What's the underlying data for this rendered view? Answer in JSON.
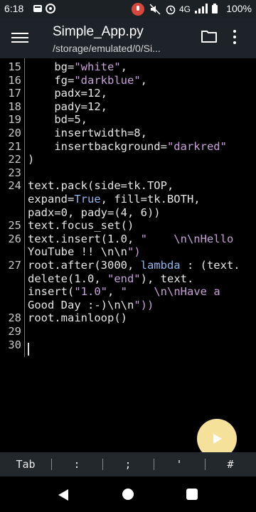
{
  "status_bar": {
    "time": "6:18",
    "network": "4G",
    "battery": "100%"
  },
  "app_bar": {
    "title": "Simple_App.py",
    "path": "/storage/emulated/0/Si..."
  },
  "editor": {
    "lines": [
      {
        "num": "15",
        "text": "    bg=\"white\","
      },
      {
        "num": "16",
        "text": "    fg=\"darkblue\","
      },
      {
        "num": "17",
        "text": "    padx=12,"
      },
      {
        "num": "18",
        "text": "    pady=12,"
      },
      {
        "num": "19",
        "text": "    bd=5,"
      },
      {
        "num": "20",
        "text": "    insertwidth=8,"
      },
      {
        "num": "21",
        "text": "    insertbackground=\"darkred\""
      },
      {
        "num": "22",
        "text": ")"
      },
      {
        "num": "23",
        "text": ""
      },
      {
        "num": "24",
        "text": "text.pack(side=tk.TOP,"
      },
      {
        "num": "",
        "text": "expand=True, fill=tk.BOTH,"
      },
      {
        "num": "",
        "text": "padx=0, pady=(4, 6))"
      },
      {
        "num": "25",
        "text": "text.focus_set()"
      },
      {
        "num": "26",
        "text": "text.insert(1.0, \"    \\n\\nHello"
      },
      {
        "num": "",
        "text": "YouTube !! \\n\\n\")"
      },
      {
        "num": "27",
        "text": "root.after(3000, lambda : (text."
      },
      {
        "num": "",
        "text": "delete(1.0, \"end\"), text."
      },
      {
        "num": "",
        "text": "insert(\"1.0\", \"    \\n\\nHave a"
      },
      {
        "num": "",
        "text": "Good Day :-)\\n\\n\"))"
      },
      {
        "num": "28",
        "text": "root.mainloop()"
      },
      {
        "num": "29",
        "text": ""
      },
      {
        "num": "30",
        "text": ""
      }
    ]
  },
  "keys": [
    "Tab",
    ":",
    ";",
    "'",
    "#"
  ],
  "colors": {
    "app_bar": "#1e2329",
    "fab": "#f6e19b",
    "string": "#c8a0d8",
    "keyword": "#8fb6ee"
  }
}
